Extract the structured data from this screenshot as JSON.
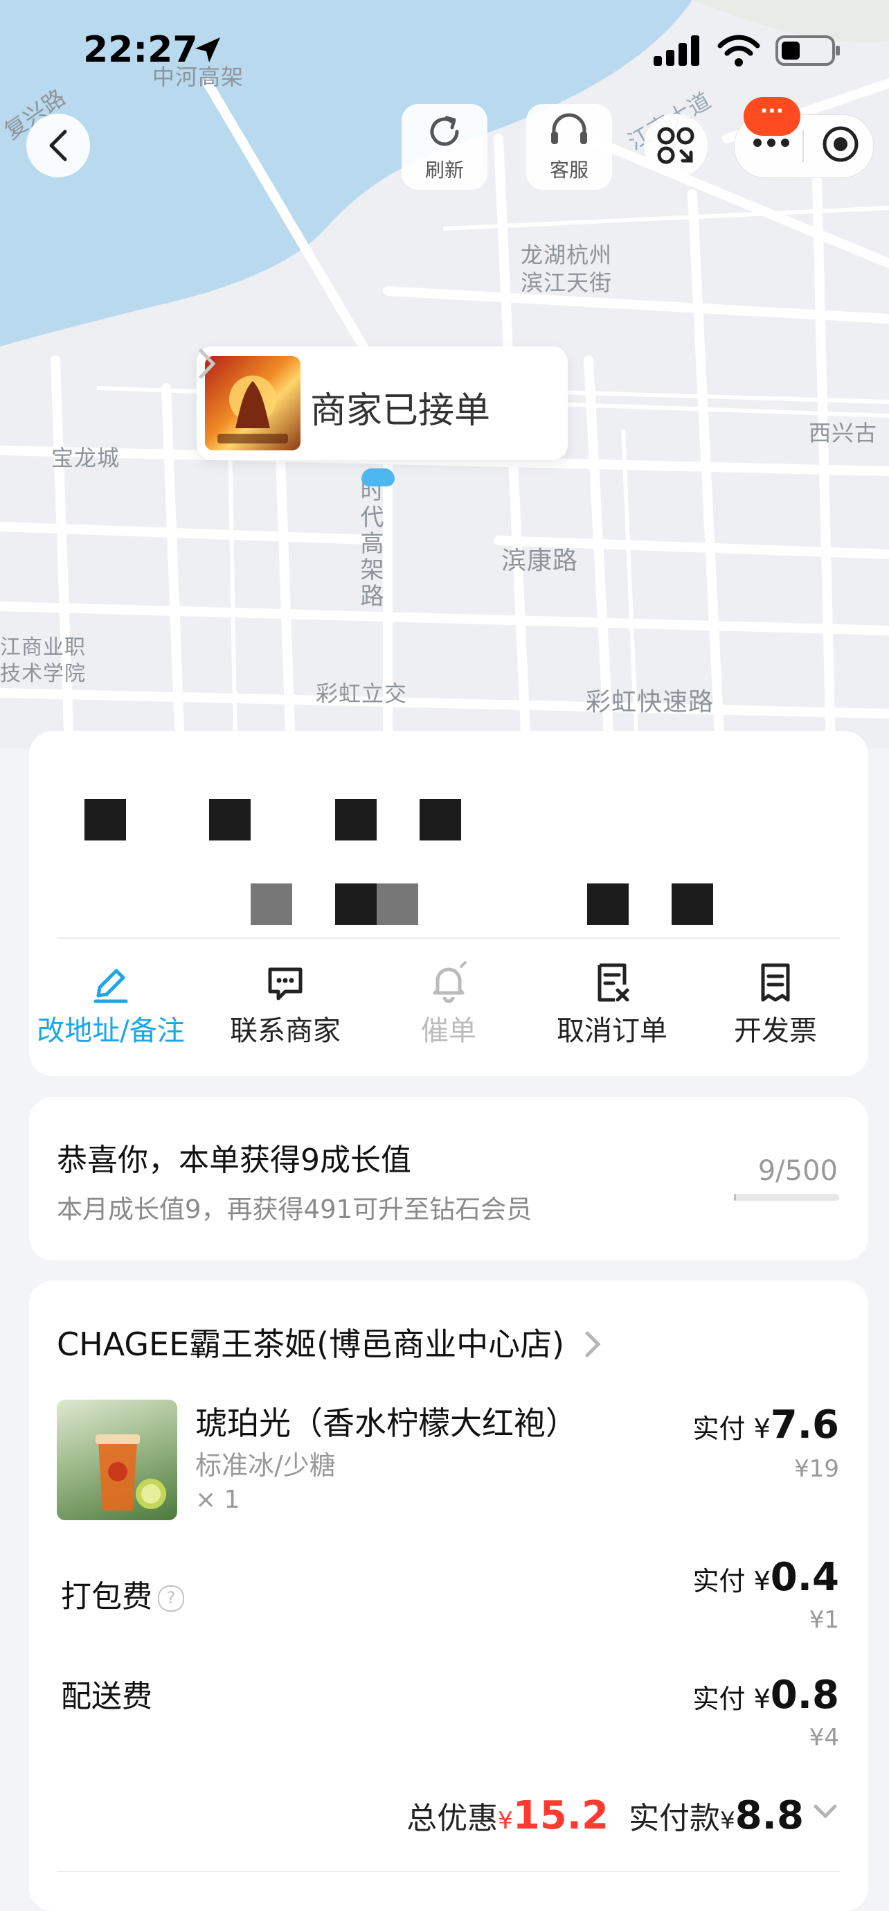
{
  "status_bar": {
    "time": "22:27"
  },
  "map": {
    "labels": {
      "zhonghe": "中河高架",
      "fuxing": "复兴路",
      "jiangnan": "江南大道",
      "longhu": "龙湖杭州\n滨江天街",
      "baolong": "宝龙城",
      "shidai": "时代高架路",
      "binkang": "滨康路",
      "xixing": "西兴古",
      "college": "江商业职\n技术学院",
      "caihong_lijiao": "彩虹立交",
      "caihong_kuaisu": "彩虹快速路"
    }
  },
  "toolbar": {
    "refresh_label": "刷新",
    "service_label": "客服",
    "badge_text": "···"
  },
  "merchant": {
    "status": "商家已接单"
  },
  "actions": {
    "edit": "改地址/备注",
    "contact": "联系商家",
    "urge": "催单",
    "cancel": "取消订单",
    "invoice": "开发票"
  },
  "colors": {
    "accent": "#1aa6e8",
    "discount": "#ff3b30",
    "disabled": "#bbbbbb"
  },
  "growth": {
    "title": "恭喜你，本单获得9成长值",
    "subtitle": "本月成长值9，再获得491可升至钻石会员",
    "progress_text": "9/500",
    "progress_fraction": 0.018
  },
  "order": {
    "store_name": "CHAGEE霸王茶姬(博邑商业中心店)",
    "item": {
      "name": "琥珀光（香水柠檬大红袍）",
      "spec": "标准冰/少糖",
      "qty": "× 1",
      "paid_prefix": "实付 ¥",
      "paid": "7.6",
      "original": "¥19"
    },
    "packing": {
      "label": "打包费",
      "help": "?",
      "paid_prefix": "实付 ¥",
      "paid": "0.4",
      "original": "¥1"
    },
    "delivery": {
      "label": "配送费",
      "paid_prefix": "实付 ¥",
      "paid": "0.8",
      "original": "¥4"
    },
    "total": {
      "discount_label": "总优惠",
      "currency": "¥",
      "discount": "15.2",
      "paid_label": "实付款",
      "paid": "8.8"
    }
  }
}
